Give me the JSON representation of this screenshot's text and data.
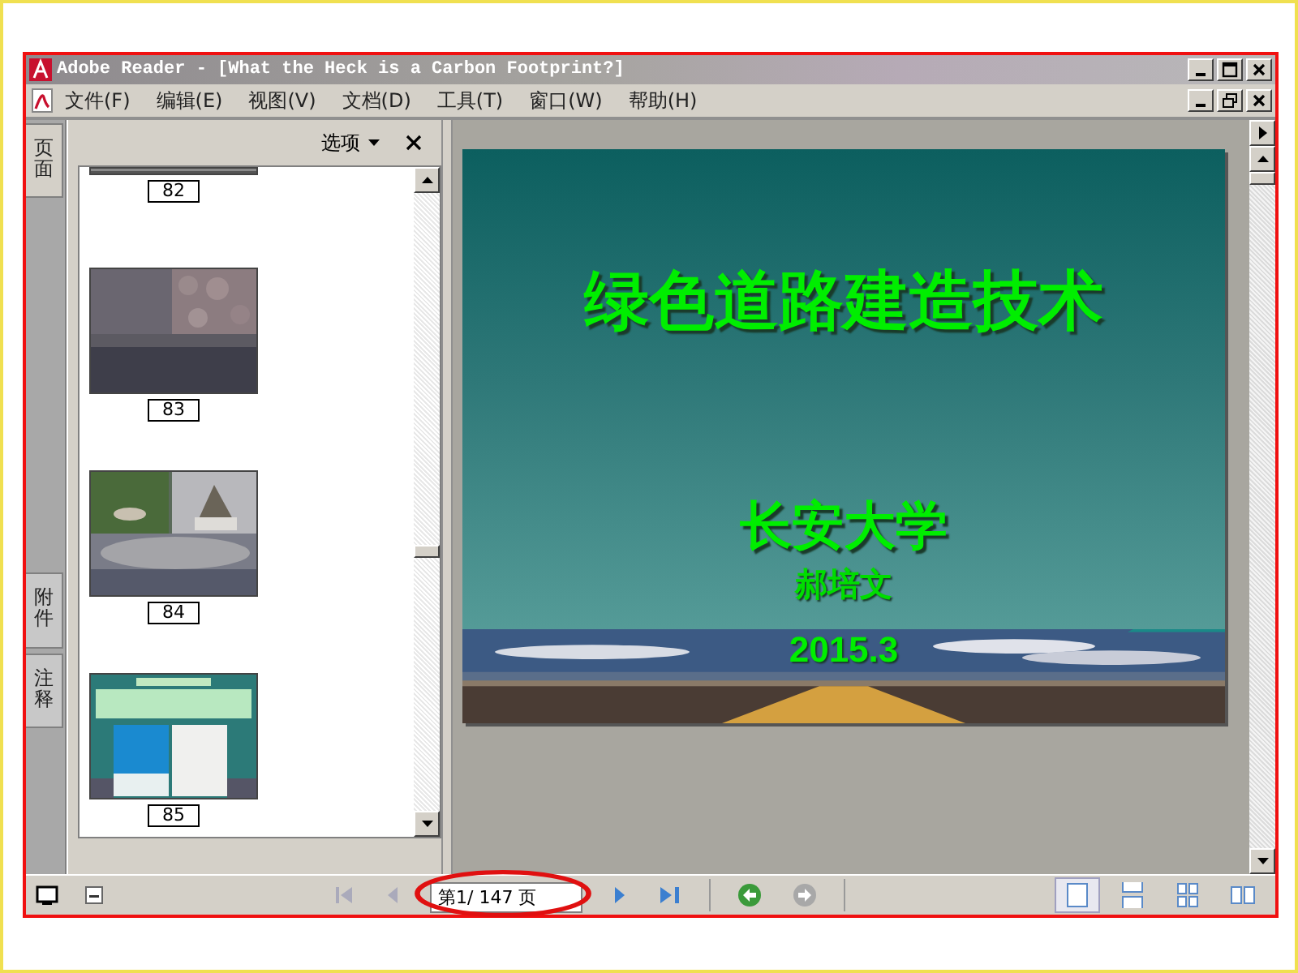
{
  "window": {
    "title": "Adobe Reader - [What the Heck is a Carbon Footprint?]"
  },
  "menu": [
    {
      "label": "文件(F)"
    },
    {
      "label": "编辑(E)"
    },
    {
      "label": "视图(V)"
    },
    {
      "label": "文档(D)"
    },
    {
      "label": "工具(T)"
    },
    {
      "label": "窗口(W)"
    },
    {
      "label": "帮助(H)"
    }
  ],
  "side_tabs": [
    {
      "label": "页面",
      "selected": true
    },
    {
      "label": "附件",
      "selected": false
    },
    {
      "label": "注释",
      "selected": false
    }
  ],
  "panel": {
    "options": "选项"
  },
  "thumbnails": [
    {
      "page": "82",
      "kind": "cut"
    },
    {
      "page": "83",
      "kind": "pavement"
    },
    {
      "page": "84",
      "kind": "garden"
    },
    {
      "page": "85",
      "kind": "slide"
    }
  ],
  "slide": {
    "title": "绿色道路建造技术",
    "org": "长安大学",
    "author": "郝培文",
    "date": "2015.3"
  },
  "nav": {
    "page_field": "第1/ 147 页"
  },
  "view_modes": [
    {
      "kind": "single",
      "selected": true
    },
    {
      "kind": "continuous",
      "selected": false
    },
    {
      "kind": "facing-continuous",
      "selected": false
    },
    {
      "kind": "facing",
      "selected": false
    }
  ]
}
